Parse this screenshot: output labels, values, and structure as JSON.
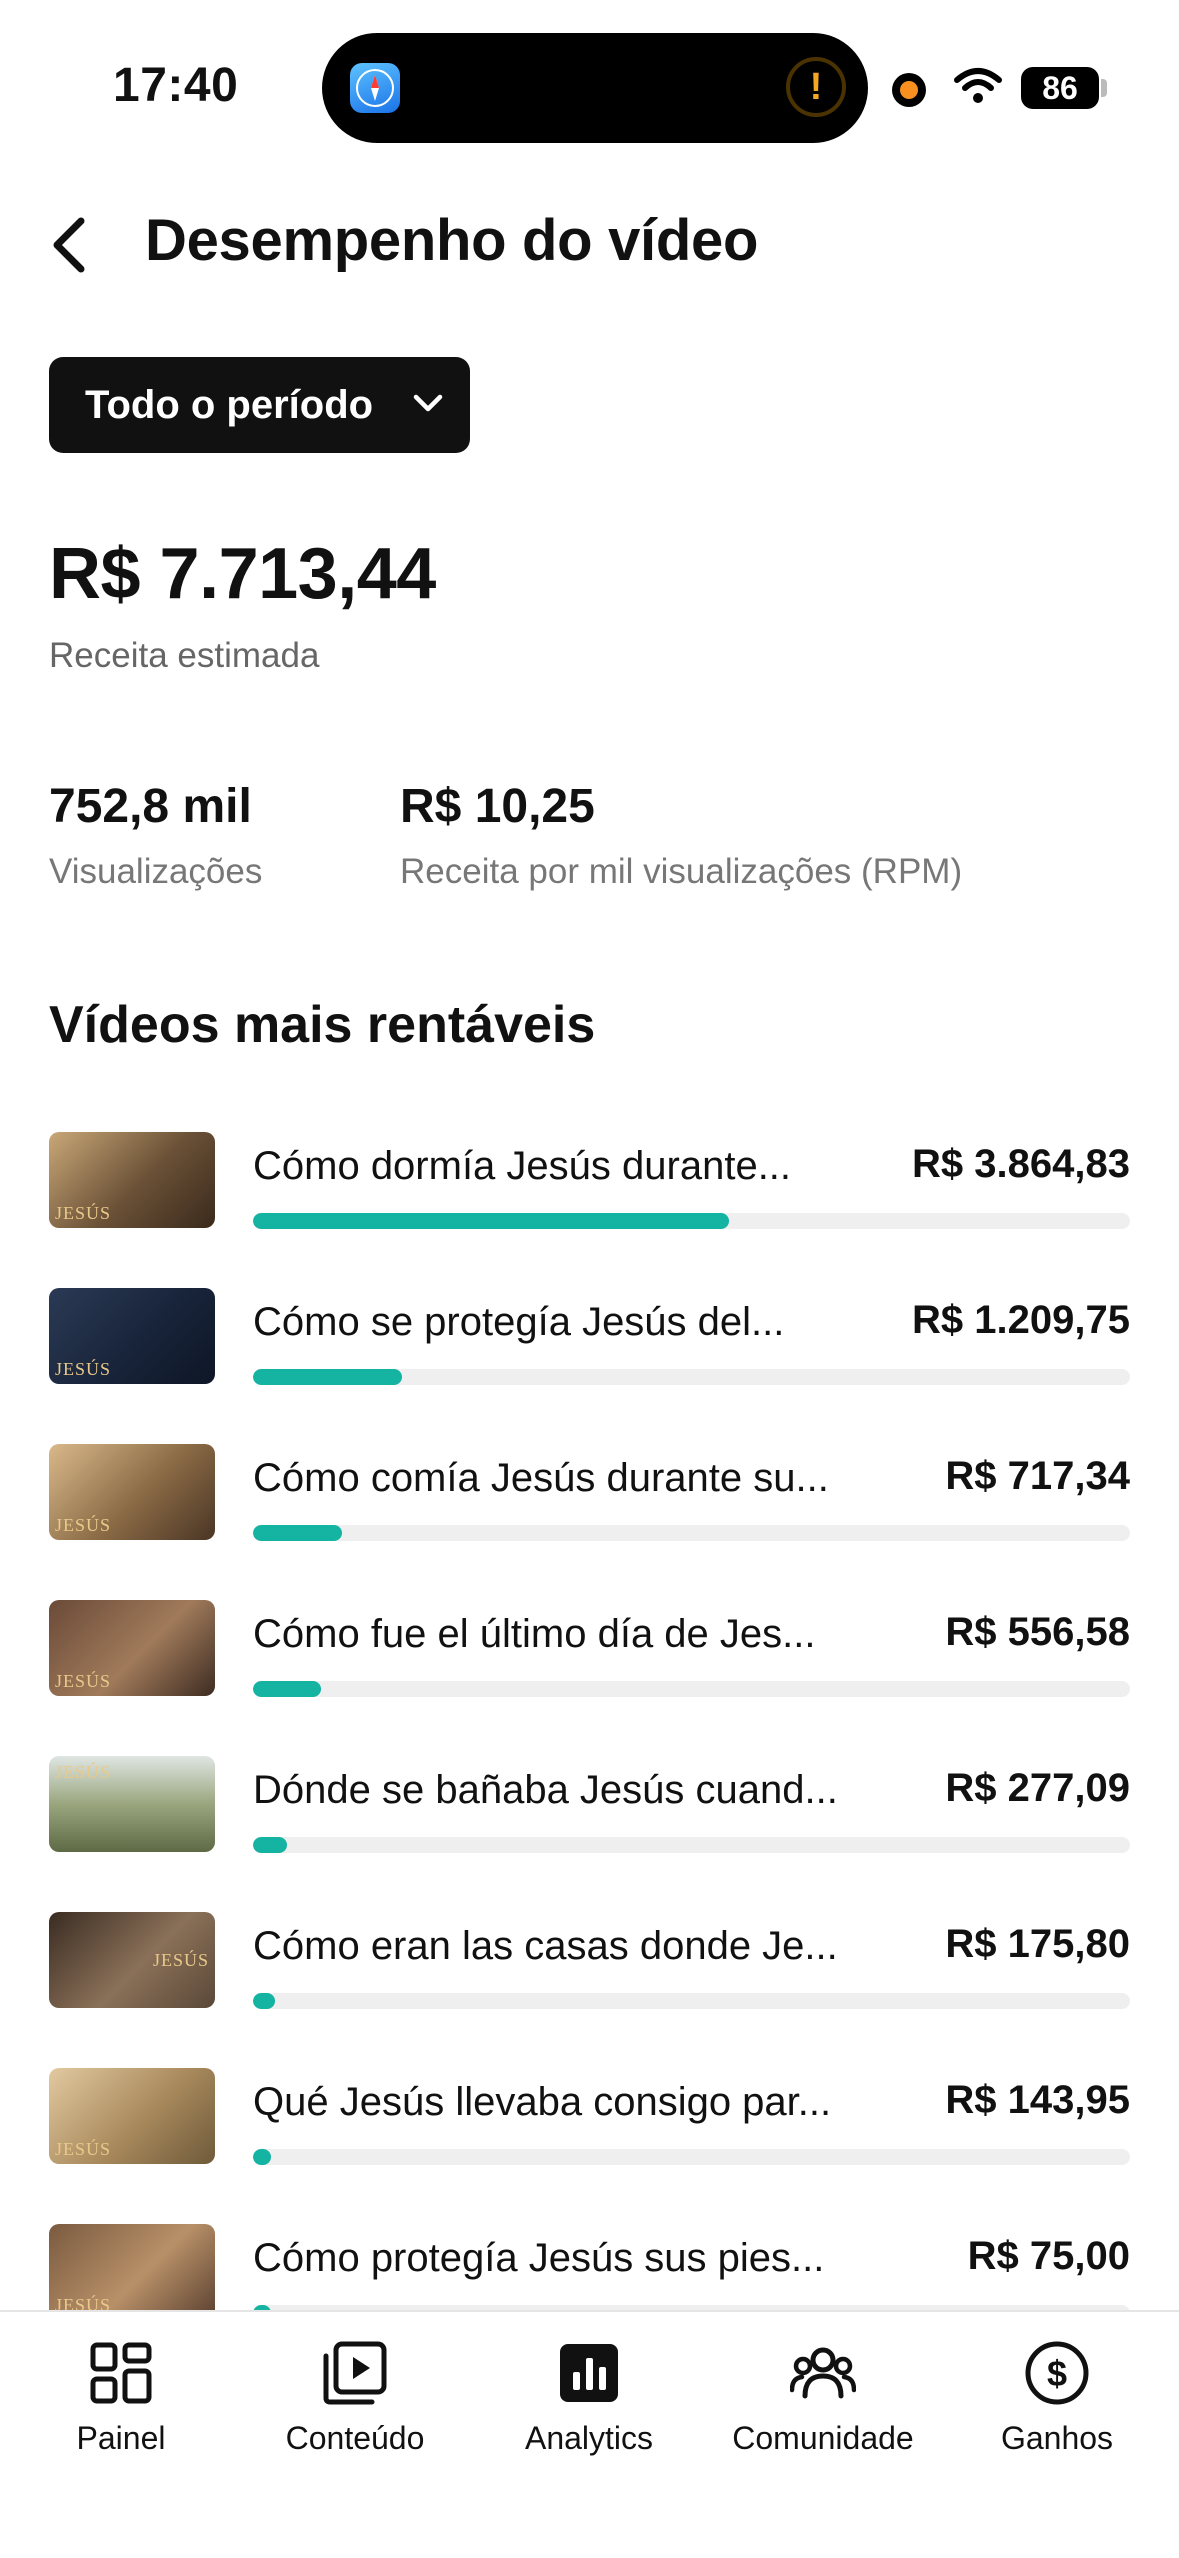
{
  "status_bar": {
    "time": "17:40",
    "battery": "86"
  },
  "header": {
    "title": "Desempenho do vídeo"
  },
  "period": {
    "label": "Todo o período"
  },
  "revenue": {
    "value": "R$ 7.713,44",
    "label": "Receita estimada"
  },
  "metrics": [
    {
      "value": "752,8 mil",
      "label": "Visualizações"
    },
    {
      "value": "R$ 10,25",
      "label": "Receita por mil visualizações (RPM)"
    }
  ],
  "section": {
    "title": "Vídeos mais rentáveis"
  },
  "videos": [
    {
      "title": "Cómo dormía Jesús durante...",
      "amount": "R$ 3.864,83",
      "share": 0.543,
      "thumb_text": "JESÚS"
    },
    {
      "title": "Cómo se protegía Jesús del...",
      "amount": "R$ 1.209,75",
      "share": 0.17,
      "thumb_text": "JESÚS"
    },
    {
      "title": "Cómo comía Jesús durante su...",
      "amount": "R$ 717,34",
      "share": 0.101,
      "thumb_text": "JESÚS"
    },
    {
      "title": "Cómo fue el último día de Jes...",
      "amount": "R$ 556,58",
      "share": 0.078,
      "thumb_text": "JESÚS"
    },
    {
      "title": "Dónde se bañaba Jesús cuand...",
      "amount": "R$ 277,09",
      "share": 0.039,
      "thumb_text": "JESÚS"
    },
    {
      "title": "Cómo eran las casas donde Je...",
      "amount": "R$ 175,80",
      "share": 0.025,
      "thumb_text": "JESÚS"
    },
    {
      "title": "Qué Jesús llevaba consigo par...",
      "amount": "R$ 143,95",
      "share": 0.02,
      "thumb_text": "JESÚS"
    },
    {
      "title": "Cómo protegía Jesús sus pies...",
      "amount": "R$ 75,00",
      "share": 0.011,
      "thumb_text": "JESÚS"
    }
  ],
  "nav": [
    {
      "label": "Painel",
      "icon": "dashboard-icon"
    },
    {
      "label": "Conteúdo",
      "icon": "content-play-icon"
    },
    {
      "label": "Analytics",
      "icon": "analytics-icon"
    },
    {
      "label": "Comunidade",
      "icon": "community-icon"
    },
    {
      "label": "Ganhos",
      "icon": "dollar-icon"
    }
  ],
  "colors": {
    "accent": "#14b3a2",
    "text": "#111111",
    "muted": "#666666"
  }
}
